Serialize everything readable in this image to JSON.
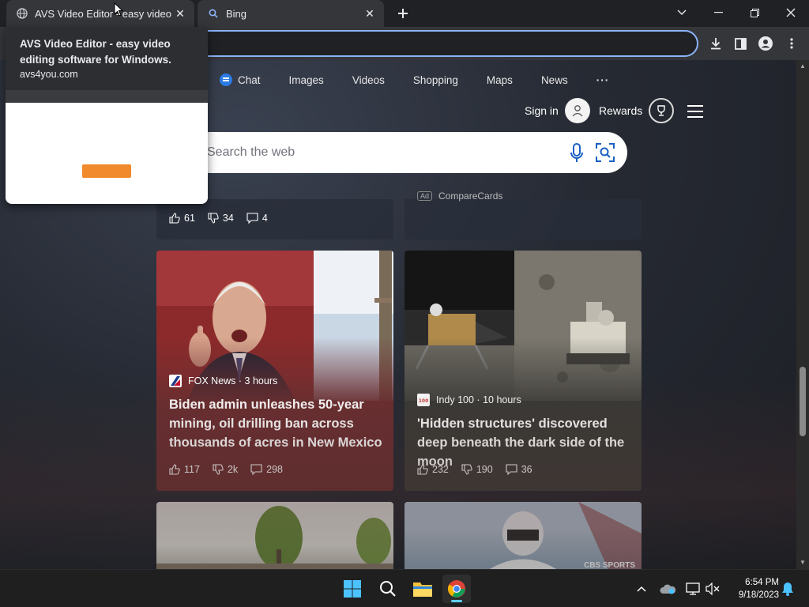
{
  "tabs": [
    {
      "title": "AVS Video Editor - easy video ed",
      "icon": "globe-icon",
      "active": false
    },
    {
      "title": "Bing",
      "icon": "search-icon",
      "active": true
    }
  ],
  "hover_preview": {
    "title": "AVS Video Editor - easy video editing software for Windows.",
    "url": "avs4you.com"
  },
  "bing": {
    "nav": [
      "Chat",
      "Images",
      "Videos",
      "Shopping",
      "Maps",
      "News"
    ],
    "more": "···",
    "sign_in": "Sign in",
    "rewards": "Rewards",
    "search_placeholder": "Search the web"
  },
  "feed": {
    "previous_row": {
      "left": {
        "likes": "61",
        "dislikes": "34",
        "comments": "4"
      },
      "right": {
        "ad_label": "Ad",
        "advertiser": "CompareCards"
      }
    },
    "cards": [
      {
        "source": "FOX News · 3 hours",
        "headline": "Biden admin unleashes 50-year mining, oil drilling ban across thousands of acres in New Mexico",
        "likes": "117",
        "dislikes": "2k",
        "comments": "298"
      },
      {
        "source": "Indy 100 · 10 hours",
        "headline": "'Hidden structures' discovered deep beneath the dark side of the moon",
        "likes": "232",
        "dislikes": "190",
        "comments": "36"
      }
    ],
    "next_row": {
      "right_overlay": "CBS SPORTS"
    }
  },
  "taskbar": {
    "time": "6:54 PM",
    "date": "9/18/2023"
  },
  "colors": {
    "accent": "#8ab4f8",
    "bing_chat": "#2a7be4",
    "card_biden": "#6b2e30",
    "card_moon": "#3a3a36"
  }
}
